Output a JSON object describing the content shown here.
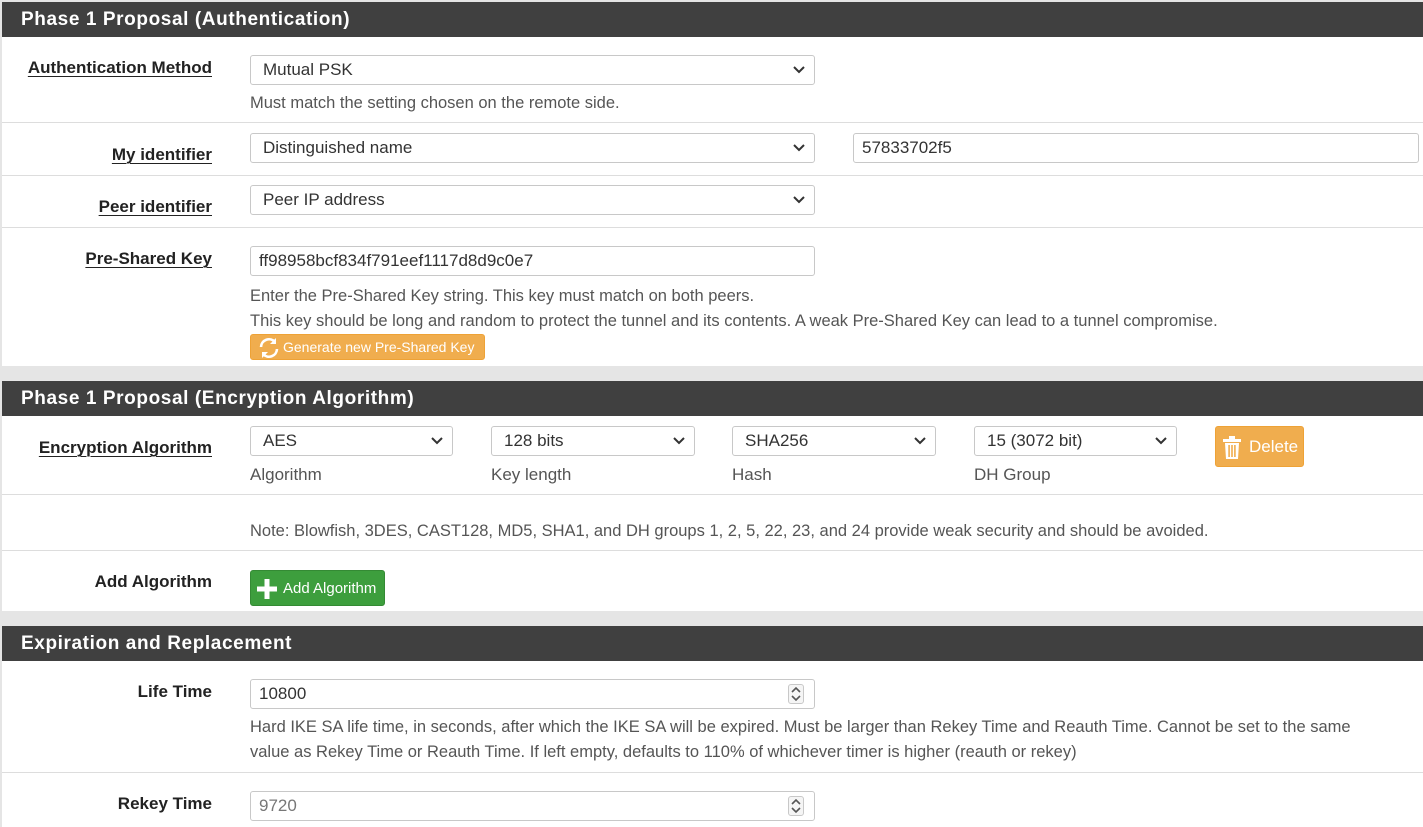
{
  "sections": {
    "auth": {
      "title": "Phase 1 Proposal (Authentication)",
      "auth_method": {
        "label": "Authentication Method",
        "value": "Mutual PSK",
        "help": "Must match the setting chosen on the remote side."
      },
      "my_identifier": {
        "label": "My identifier",
        "type_value": "Distinguished name",
        "value": "57833702f5"
      },
      "peer_identifier": {
        "label": "Peer identifier",
        "value": "Peer IP address"
      },
      "psk": {
        "label": "Pre-Shared Key",
        "value": "ff98958bcf834f791eef1117d8d9c0e7",
        "help1": "Enter the Pre-Shared Key string. This key must match on both peers.",
        "help2": "This key should be long and random to protect the tunnel and its contents. A weak Pre-Shared Key can lead to a tunnel compromise.",
        "generate_button": "Generate new Pre-Shared Key"
      }
    },
    "encryption": {
      "title": "Phase 1 Proposal (Encryption Algorithm)",
      "label": "Encryption Algorithm",
      "algorithm": {
        "value": "AES",
        "sublabel": "Algorithm"
      },
      "key_length": {
        "value": "128 bits",
        "sublabel": "Key length"
      },
      "hash": {
        "value": "SHA256",
        "sublabel": "Hash"
      },
      "dh_group": {
        "value": "15 (3072 bit)",
        "sublabel": "DH Group"
      },
      "delete_button": "Delete",
      "note": "Note: Blowfish, 3DES, CAST128, MD5, SHA1, and DH groups 1, 2, 5, 22, 23, and 24 provide weak security and should be avoided.",
      "add_label": "Add Algorithm",
      "add_button": "Add Algorithm"
    },
    "expiration": {
      "title": "Expiration and Replacement",
      "life_time": {
        "label": "Life Time",
        "value": "10800",
        "help1": "Hard IKE SA life time, in seconds, after which the IKE SA will be expired. Must be larger than Rekey Time and Reauth Time. Cannot be set to the same",
        "help2": "value as Rekey Time or Reauth Time. If left empty, defaults to 110% of whichever timer is higher (reauth or rekey)"
      },
      "rekey_time": {
        "label": "Rekey Time",
        "placeholder": "9720"
      }
    }
  },
  "colors": {
    "header_bg": "#404040",
    "warning": "#f0ad4e",
    "success": "#3d9e3d"
  }
}
